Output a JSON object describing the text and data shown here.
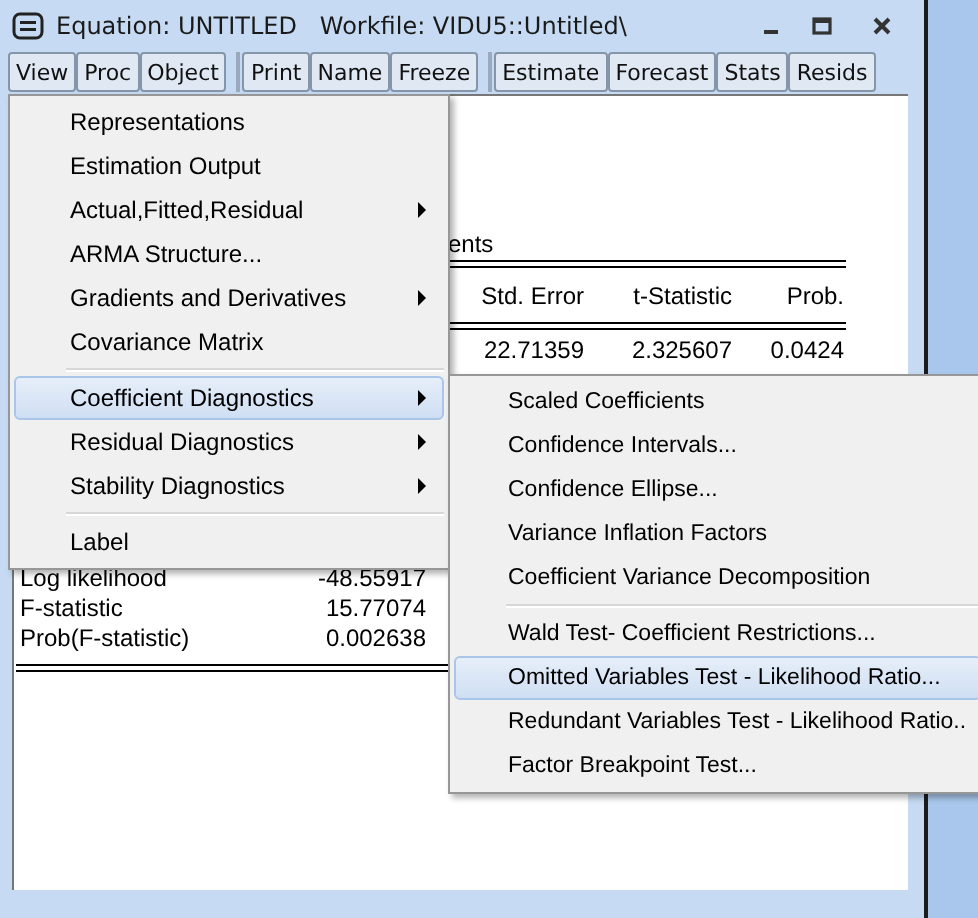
{
  "window": {
    "title": "Equation: UNTITLED   Workfile: VIDU5::Untitled\\"
  },
  "toolbar": [
    {
      "buttons": [
        "View",
        "Proc",
        "Object"
      ]
    },
    {
      "buttons": [
        "Print",
        "Name",
        "Freeze"
      ]
    },
    {
      "buttons": [
        "Estimate",
        "Forecast",
        "Stats",
        "Resids"
      ]
    }
  ],
  "output": {
    "heading": "ents",
    "columns": [
      "Std. Error",
      "t-Statistic",
      "Prob."
    ],
    "rows": [
      [
        "22.71359",
        "2.325607",
        "0.0424"
      ]
    ],
    "stats": [
      {
        "label": "Log likelihood",
        "value": "-48.55917"
      },
      {
        "label": "F-statistic",
        "value": "15.77074"
      },
      {
        "label": "Prob(F-statistic)",
        "value": "0.002638"
      }
    ]
  },
  "view_menu": {
    "items": [
      {
        "kind": "item",
        "label": "Representations",
        "submenu": false,
        "selected": false
      },
      {
        "kind": "item",
        "label": "Estimation Output",
        "submenu": false,
        "selected": false
      },
      {
        "kind": "item",
        "label": "Actual,Fitted,Residual",
        "submenu": true,
        "selected": false
      },
      {
        "kind": "item",
        "label": "ARMA Structure...",
        "submenu": false,
        "selected": false
      },
      {
        "kind": "item",
        "label": "Gradients and Derivatives",
        "submenu": true,
        "selected": false
      },
      {
        "kind": "item",
        "label": "Covariance Matrix",
        "submenu": false,
        "selected": false
      },
      {
        "kind": "separator"
      },
      {
        "kind": "item",
        "label": "Coefficient Diagnostics",
        "submenu": true,
        "selected": true
      },
      {
        "kind": "item",
        "label": "Residual Diagnostics",
        "submenu": true,
        "selected": false
      },
      {
        "kind": "item",
        "label": "Stability Diagnostics",
        "submenu": true,
        "selected": false
      },
      {
        "kind": "separator"
      },
      {
        "kind": "item",
        "label": "Label",
        "submenu": false,
        "selected": false
      }
    ]
  },
  "coefficient_submenu": {
    "items": [
      {
        "kind": "item",
        "label": "Scaled Coefficients",
        "submenu": false,
        "selected": false
      },
      {
        "kind": "item",
        "label": "Confidence Intervals...",
        "submenu": false,
        "selected": false
      },
      {
        "kind": "item",
        "label": "Confidence Ellipse...",
        "submenu": false,
        "selected": false
      },
      {
        "kind": "item",
        "label": "Variance Inflation Factors",
        "submenu": false,
        "selected": false
      },
      {
        "kind": "item",
        "label": "Coefficient Variance Decomposition",
        "submenu": false,
        "selected": false
      },
      {
        "kind": "separator"
      },
      {
        "kind": "item",
        "label": "Wald Test- Coefficient Restrictions...",
        "submenu": false,
        "selected": false
      },
      {
        "kind": "item",
        "label": "Omitted Variables Test - Likelihood Ratio...",
        "submenu": false,
        "selected": true
      },
      {
        "kind": "item",
        "label": "Redundant Variables Test - Likelihood Ratio..",
        "submenu": false,
        "selected": false
      },
      {
        "kind": "item",
        "label": "Factor Breakpoint Test...",
        "submenu": false,
        "selected": false
      }
    ]
  }
}
